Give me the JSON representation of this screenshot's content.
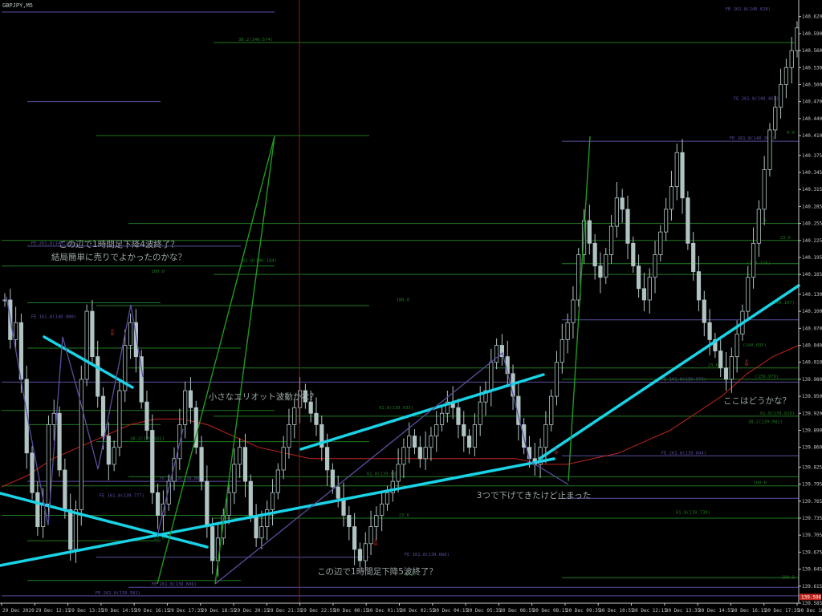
{
  "symbol": "GBPJPY,M5",
  "chart_data": {
    "type": "candlestick",
    "ylim": [
      139.585,
      140.645
    ],
    "y_ticks": [
      "140.620",
      "140.590",
      "140.560",
      "140.530",
      "140.500",
      "140.470",
      "140.440",
      "140.410",
      "140.375",
      "140.345",
      "140.315",
      "140.285",
      "140.255",
      "140.225",
      "140.195",
      "140.165",
      "140.130",
      "140.100",
      "140.070",
      "140.040",
      "140.010",
      "139.980",
      "139.950",
      "139.920",
      "139.890",
      "139.860",
      "139.825",
      "139.795",
      "139.765",
      "139.735",
      "139.705",
      "139.675",
      "139.645",
      "139.615",
      "139.585"
    ],
    "x_ticks": [
      "29 Dec 2020",
      "29 Dec 12:15",
      "29 Dec 13:35",
      "29 Dec 14:55",
      "29 Dec 16:15",
      "29 Dec 17:35",
      "29 Dec 18:55",
      "29 Dec 20:15",
      "29 Dec 21:35",
      "29 Dec 22:55",
      "30 Dec 00:15",
      "30 Dec 01:35",
      "30 Dec 02:55",
      "30 Dec 04:15",
      "30 Dec 05:35",
      "30 Dec 06:55",
      "30 Dec 08:15",
      "30 Dec 09:35",
      "30 Dec 10:55",
      "30 Dec 12:15",
      "30 Dec 13:35",
      "30 Dec 14:55",
      "30 Dec 16:15",
      "30 Dec 17:35",
      "30 Dec 18:55"
    ],
    "current_price": "139.596",
    "series": [
      {
        "name": "price",
        "points": [
          140.12,
          140.05,
          140.08,
          139.98,
          139.85,
          139.78,
          139.72,
          139.76,
          139.9,
          139.92,
          139.82,
          139.75,
          139.68,
          139.75,
          139.98,
          140.1,
          140.02,
          139.95,
          139.88,
          139.83,
          139.86,
          139.96,
          140.04,
          140.08,
          140.02,
          139.94,
          139.89,
          139.78,
          139.74,
          139.76,
          139.8,
          139.84,
          139.9,
          139.96,
          139.93,
          139.86,
          139.8,
          139.72,
          139.66,
          139.7,
          139.74,
          139.78,
          139.83,
          139.86,
          139.8,
          139.74,
          139.7,
          139.72,
          139.75,
          139.78,
          139.82,
          139.86,
          139.9,
          139.93,
          139.96,
          139.94,
          139.92,
          139.9,
          139.86,
          139.82,
          139.79,
          139.77,
          139.74,
          139.72,
          139.68,
          139.66,
          139.69,
          139.72,
          139.74,
          139.76,
          139.78,
          139.8,
          139.83,
          139.86,
          139.88,
          139.86,
          139.84,
          139.86,
          139.88,
          139.9,
          139.92,
          139.94,
          139.93,
          139.9,
          139.88,
          139.86,
          139.9,
          139.94,
          139.96,
          140.01,
          140.04,
          140.02,
          139.99,
          139.95,
          139.9,
          139.86,
          139.84,
          139.83,
          139.86,
          139.9,
          139.95,
          140.01,
          140.05,
          140.08,
          140.12,
          140.2,
          140.26,
          140.22,
          140.18,
          140.16,
          140.2,
          140.25,
          140.3,
          140.28,
          140.22,
          140.18,
          140.14,
          140.12,
          140.16,
          140.2,
          140.24,
          140.28,
          140.32,
          140.38,
          140.3,
          140.22,
          140.17,
          140.12,
          140.08,
          140.05,
          140.03,
          140.0,
          139.98,
          140.02,
          140.06,
          140.1,
          140.16,
          140.22,
          140.28,
          140.35,
          140.42,
          140.46,
          140.5,
          140.53,
          140.56,
          140.6
        ]
      },
      {
        "name": "moving-average",
        "points": [
          139.79,
          139.81,
          139.84,
          139.86,
          139.88,
          139.9,
          139.91,
          139.91,
          139.9,
          139.88,
          139.86,
          139.85,
          139.84,
          139.84,
          139.84,
          139.84,
          139.84,
          139.84,
          139.84,
          139.84,
          139.84,
          139.83,
          139.83,
          139.84,
          139.85,
          139.87,
          139.89,
          139.92,
          139.95,
          139.99,
          140.02,
          140.04
        ]
      }
    ],
    "horizontal_levels": [
      {
        "label": "FE 261.8(140.628)",
        "price": 140.628,
        "color": "#5b4fa0"
      },
      {
        "label": "38.2(140.574)",
        "price": 140.574,
        "color": "#1f7a1f"
      },
      {
        "label": "FE 261.8(140.461)",
        "price": 140.47,
        "color": "#5b4fa0"
      },
      {
        "label": "0.0",
        "price": 140.41,
        "color": "#1f7a1f"
      },
      {
        "label": "FE 261.8(140.398)",
        "price": 140.4,
        "color": "#5b4fa0"
      },
      {
        "label": "FE 261.8(140.215)",
        "price": 140.215,
        "color": "#5b4fa0"
      },
      {
        "label": "23.6",
        "price": 140.255,
        "color": "#1f7a1f"
      },
      {
        "label": "23.6",
        "price": 140.225,
        "color": "#1f7a1f"
      },
      {
        "label": "61.8(140.184)",
        "price": 140.184,
        "color": "#1f7a1f"
      },
      {
        "label": "(140.176)",
        "price": 140.18,
        "color": "#1f7a1f"
      },
      {
        "label": "100.0",
        "price": 140.165,
        "color": "#1f7a1f"
      },
      {
        "label": "100.0",
        "price": 140.115,
        "color": "#1f7a1f"
      },
      {
        "label": "(140.107)",
        "price": 140.11,
        "color": "#1f7a1f"
      },
      {
        "label": "FE 161.8(140.080)",
        "price": 140.085,
        "color": "#5b4fa0"
      },
      {
        "label": "(140.035)",
        "price": 140.035,
        "color": "#1f7a1f"
      },
      {
        "label": "23.6",
        "price": 140.0,
        "color": "#1f7a1f"
      },
      {
        "label": "FE 161.8(139.979)",
        "price": 139.975,
        "color": "#5b4fa0"
      },
      {
        "label": "(139.979)",
        "price": 139.98,
        "color": "#1f7a1f"
      },
      {
        "label": "61.8(139.933)",
        "price": 139.925,
        "color": "#1f7a1f"
      },
      {
        "label": "61.8(139.918)",
        "price": 139.915,
        "color": "#1f7a1f"
      },
      {
        "label": "38.2(139.901)",
        "price": 139.9,
        "color": "#1f7a1f"
      },
      {
        "label": "38.2(139.922)",
        "price": 139.87,
        "color": "#1f7a1f"
      },
      {
        "label": "FE 261.8(139.844)",
        "price": 139.845,
        "color": "#5b4fa0"
      },
      {
        "label": "FE 261.8(139.807)",
        "price": 139.8,
        "color": "#5b4fa0"
      },
      {
        "label": "61.8(139.808)",
        "price": 139.808,
        "color": "#1f7a1f"
      },
      {
        "label": "100.0",
        "price": 139.792,
        "color": "#1f7a1f"
      },
      {
        "label": "FE 161.8(139.777)",
        "price": 139.77,
        "color": "#5b4fa0"
      },
      {
        "label": "61.8(139.739)",
        "price": 139.74,
        "color": "#1f7a1f"
      },
      {
        "label": "23.6",
        "price": 139.735,
        "color": "#1f7a1f"
      },
      {
        "label": "23.6",
        "price": 139.695,
        "color": "#1f7a1f"
      },
      {
        "label": "FE 161.8(139.666)",
        "price": 139.666,
        "color": "#5b4fa0"
      },
      {
        "label": "0.0",
        "price": 139.63,
        "color": "#1f7a1f"
      },
      {
        "label": "100.0",
        "price": 139.625,
        "color": "#1f7a1f"
      },
      {
        "label": "FE 261.8(139.606)",
        "price": 139.613,
        "color": "#5b4fa0"
      },
      {
        "label": "FE 261.8(139.581)",
        "price": 139.598,
        "color": "#5b4fa0"
      }
    ],
    "annotations": [
      "この辺で1時間足下降4波終了？",
      "結局簡単に売りでよかったのかな？",
      "小さなエリオット波動かな？",
      "3つで下げてきたけど止まった",
      "この辺で1時間足下降5波終了？",
      "ここはどうかな？"
    ],
    "colors": {
      "background": "#000000",
      "candle": "#b0c4c4",
      "trendline": "#19d3e6",
      "wave": "#5b4fa0",
      "fib": "#1f7a1f",
      "ma": "#c0251c",
      "vline": "#8b1a1a",
      "price_tag": "#c0251c",
      "arrow": "#e03030",
      "text": "#9aa6a6"
    }
  }
}
